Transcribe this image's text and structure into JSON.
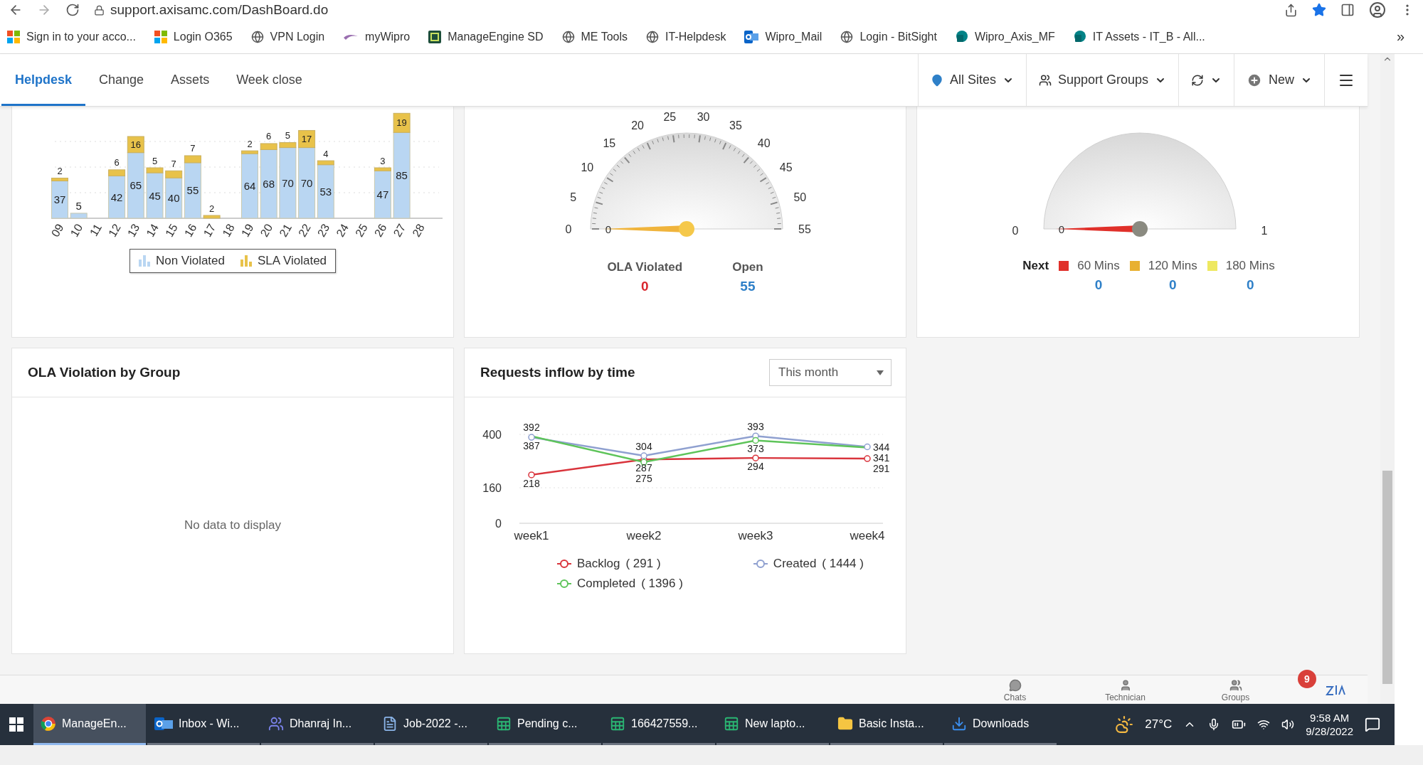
{
  "browser": {
    "url": "support.axisamc.com/DashBoard.do",
    "more": "»",
    "bookmarks": [
      {
        "kind": "ms",
        "label": "Sign in to your acco..."
      },
      {
        "kind": "ms",
        "label": "Login O365"
      },
      {
        "kind": "globe",
        "label": "VPN Login"
      },
      {
        "kind": "wipro",
        "label": "myWipro"
      },
      {
        "kind": "me",
        "label": "ManageEngine SD"
      },
      {
        "kind": "globe",
        "label": "ME Tools"
      },
      {
        "kind": "globe",
        "label": "IT-Helpdesk"
      },
      {
        "kind": "outlook",
        "label": "Wipro_Mail"
      },
      {
        "kind": "globe",
        "label": "Login - BitSight"
      },
      {
        "kind": "sharepoint",
        "label": "Wipro_Axis_MF"
      },
      {
        "kind": "sharepoint",
        "label": "IT Assets - IT_B - All..."
      }
    ]
  },
  "nav": {
    "tabs": [
      {
        "label": "Helpdesk",
        "selected": true
      },
      {
        "label": "Change",
        "selected": false
      },
      {
        "label": "Assets",
        "selected": false
      },
      {
        "label": "Week close",
        "selected": false
      }
    ],
    "controls": [
      {
        "kind": "sites",
        "label": "All Sites"
      },
      {
        "kind": "groups",
        "label": "Support Groups"
      },
      {
        "kind": "refresh"
      },
      {
        "kind": "new",
        "label": "New"
      },
      {
        "kind": "menu"
      }
    ]
  },
  "sla_chart": {
    "chart_data": {
      "type": "bar",
      "stacked": true,
      "data_labels": true,
      "categories": [
        "09",
        "10",
        "11",
        "12",
        "13",
        "14",
        "15",
        "16",
        "17",
        "18",
        "19",
        "20",
        "21",
        "22",
        "23",
        "24",
        "25",
        "26",
        "27",
        "28"
      ],
      "series": [
        {
          "name": "Non Violated",
          "color": "#b9d6f2",
          "values": [
            37,
            5,
            null,
            42,
            65,
            45,
            40,
            55,
            null,
            null,
            64,
            68,
            70,
            70,
            53,
            null,
            null,
            47,
            85,
            null
          ]
        },
        {
          "name": "SLA Violated",
          "color": "#e8c24a",
          "values": [
            2,
            null,
            null,
            6,
            16,
            5,
            7,
            7,
            2,
            null,
            2,
            6,
            5,
            17,
            4,
            null,
            null,
            3,
            19,
            null
          ]
        }
      ]
    }
  },
  "ola_gauge": {
    "ticks": [
      "0",
      "5",
      "10",
      "15",
      "20",
      "25",
      "30",
      "35",
      "40",
      "45",
      "50",
      "55"
    ],
    "needle_label": "0",
    "stats": [
      {
        "label": "OLA Violated",
        "value": "0",
        "color": "#d9272e"
      },
      {
        "label": "Open",
        "value": "55",
        "color": "#2f80c8"
      }
    ]
  },
  "due_gauge": {
    "min": "0",
    "max": "1",
    "needle_label": "0",
    "legend_title": "Next",
    "legend": [
      {
        "label": "60 Mins",
        "color": "#e0302a",
        "count": "0"
      },
      {
        "label": "120 Mins",
        "color": "#e8b030",
        "count": "0"
      },
      {
        "label": "180 Mins",
        "color": "#eee860",
        "count": "0"
      }
    ]
  },
  "ola_group": {
    "title": "OLA Violation by Group",
    "empty": "No data to display"
  },
  "inflow": {
    "title": "Requests inflow by time",
    "period": "This month",
    "legend_counts": [
      "( 291 )",
      "( 1444 )",
      "( 1396 )"
    ],
    "chart_data": {
      "type": "line",
      "data_labels": true,
      "categories": [
        "week1",
        "week2",
        "week3",
        "week4"
      ],
      "ylim": [
        0,
        400
      ],
      "yticks": [
        0,
        160,
        400
      ],
      "series": [
        {
          "name": "Backlog",
          "color": "#d9343c",
          "marker": "circle",
          "values": [
            218,
            287,
            294,
            291
          ]
        },
        {
          "name": "Created",
          "color": "#8fa0d0",
          "marker": "circle",
          "values": [
            387,
            304,
            393,
            344
          ]
        },
        {
          "name": "Completed",
          "color": "#5ec45a",
          "marker": "circle",
          "values": [
            392,
            275,
            373,
            341
          ]
        }
      ]
    }
  },
  "footer": {
    "items": [
      {
        "kind": "chats",
        "label": "Chats"
      },
      {
        "kind": "technician",
        "label": "Technician"
      },
      {
        "kind": "groups",
        "label": "Groups"
      }
    ],
    "badge": "9"
  },
  "taskbar": {
    "items": [
      {
        "kind": "chrome",
        "label": "ManageEn...",
        "selected": true
      },
      {
        "kind": "outlook",
        "label": "Inbox - Wi...",
        "selected": false
      },
      {
        "kind": "teams",
        "label": "Dhanraj In...",
        "selected": false
      },
      {
        "kind": "file",
        "label": "Job-2022 -...",
        "selected": false
      },
      {
        "kind": "excel",
        "label": "Pending c...",
        "selected": false
      },
      {
        "kind": "excel",
        "label": "166427559...",
        "selected": false
      },
      {
        "kind": "excel",
        "label": "New lapto...",
        "selected": false
      },
      {
        "kind": "folder",
        "label": "Basic Insta...",
        "selected": false
      },
      {
        "kind": "download",
        "label": "Downloads",
        "selected": false
      }
    ],
    "temperature": "27°C",
    "time": "9:58 AM",
    "date": "9/28/2022"
  }
}
